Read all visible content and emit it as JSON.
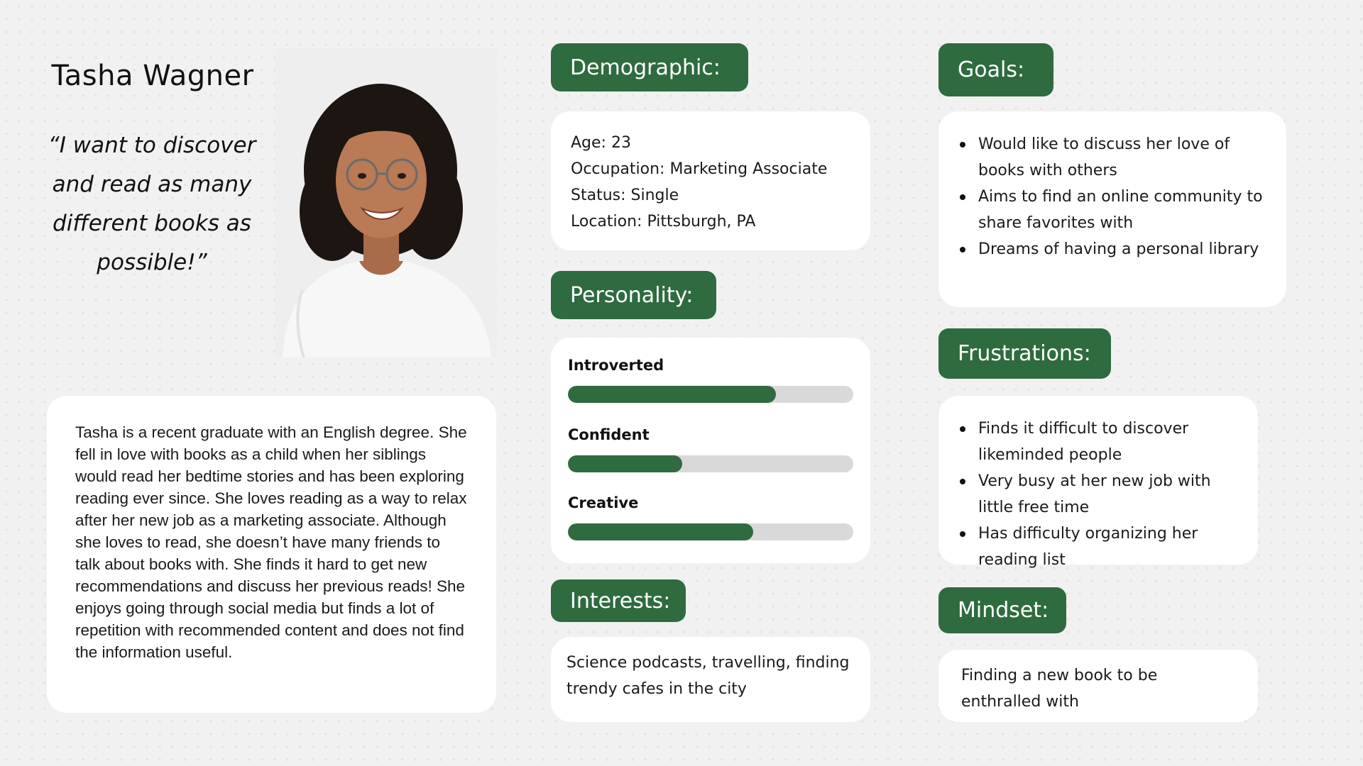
{
  "persona": {
    "name": "Tasha Wagner",
    "quote": "“I want to discover and read as many different books as possible!”",
    "bio": "Tasha is a recent graduate with an English degree. She fell in love with books as a child when her siblings would read her bedtime stories and has been exploring reading ever since. She loves reading as a way to relax after her new job as a marketing associate. Although she loves to read, she doesn’t have many friends to talk about books with. She finds it hard to get new recommendations and discuss her previous reads! She enjoys going through social media but finds a lot of repetition with recommended content and does not find the information useful."
  },
  "demographic": {
    "heading": "Demographic:",
    "lines": [
      "Age: 23",
      "Occupation: Marketing Associate",
      "Status: Single",
      "Location: Pittsburgh, PA"
    ]
  },
  "personality": {
    "heading": "Personality:",
    "traits": [
      {
        "label": "Introverted",
        "level": 0.73
      },
      {
        "label": "Confident",
        "level": 0.4
      },
      {
        "label": "Creative",
        "level": 0.65
      }
    ]
  },
  "interests": {
    "heading": "Interests:",
    "text": "Science podcasts, travelling, finding trendy cafes in the city"
  },
  "goals": {
    "heading": "Goals:",
    "items": [
      "Would like to discuss her love of books with others",
      "Aims to find an online community to share favorites with",
      "Dreams of having a personal library"
    ]
  },
  "frustrations": {
    "heading": "Frustrations:",
    "items": [
      "Finds it difficult to discover likeminded people",
      "Very busy at her new job with little free time",
      "Has difficulty organizing her reading list"
    ]
  },
  "mindset": {
    "heading": "Mindset:",
    "text": "Finding a new book to be enthralled with"
  },
  "colors": {
    "accent": "#2e6b3f",
    "track": "#d9d9d9",
    "card": "#ffffff"
  }
}
